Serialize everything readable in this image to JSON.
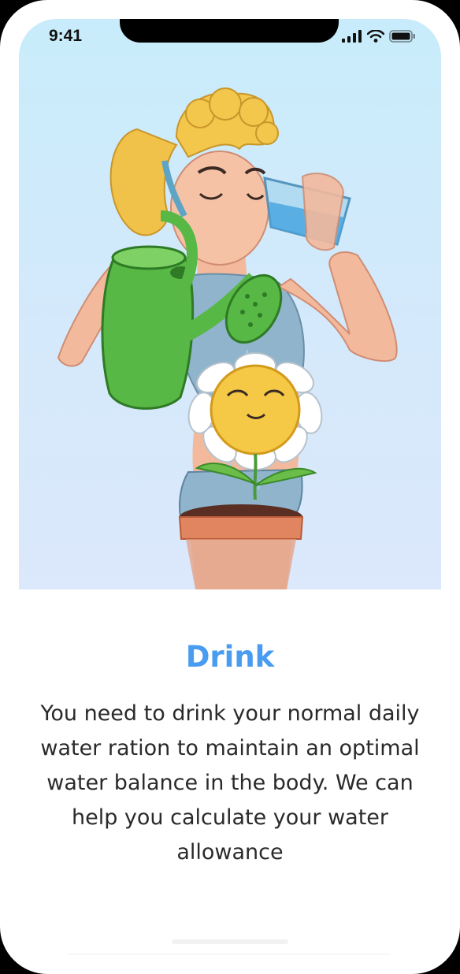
{
  "status_bar": {
    "time": "9:41",
    "icons": [
      "cellular-signal-icon",
      "wifi-icon",
      "battery-icon"
    ]
  },
  "onboarding": {
    "illustration": "woman-drinking-water-watering-flower-illustration",
    "title": "Drink",
    "description": "You need to drink your normal daily water ration to maintain an optimal water balance in the body. We can help you calculate your water allowance"
  },
  "colors": {
    "accent": "#4a9cf0",
    "hero_background": "#cdeafb",
    "text": "#2a2a2a"
  }
}
